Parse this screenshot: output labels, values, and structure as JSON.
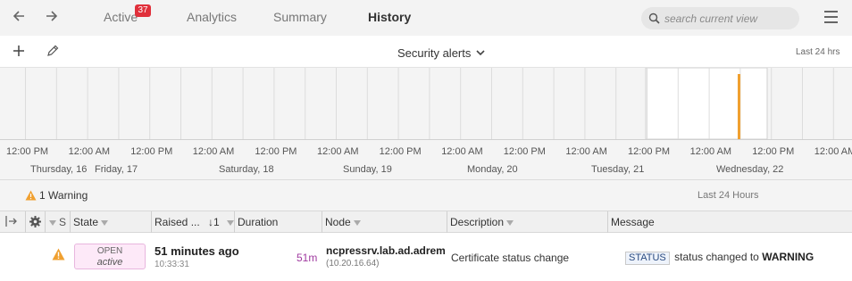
{
  "nav": {
    "tabs": [
      {
        "label": "Active",
        "badge": "37"
      },
      {
        "label": "Analytics"
      },
      {
        "label": "Summary"
      },
      {
        "label": "History"
      }
    ],
    "search_placeholder": "search current view"
  },
  "toolbar": {
    "view_name": "Security alerts",
    "time_range": "Last 24 hrs"
  },
  "timeline": {
    "tick_labels": [
      "12:00 PM",
      "12:00 AM",
      "12:00 PM",
      "12:00 AM",
      "12:00 PM",
      "12:00 AM",
      "12:00 PM",
      "12:00 AM",
      "12:00 PM",
      "12:00 AM",
      "12:00 PM",
      "12:00 AM",
      "12:00 PM",
      "12:00 AM"
    ],
    "day_labels": [
      "Thursday, 16",
      "Friday, 17",
      "Saturday, 18",
      "Sunday, 19",
      "Monday, 20",
      "Tuesday, 21",
      "Wednesday, 22"
    ],
    "event_color": "#f0a030"
  },
  "summary": {
    "warning_count_text": "1 Warning",
    "period": "Last 24 Hours"
  },
  "table": {
    "headers": {
      "state": "State",
      "raised": "Raised ...",
      "sort": "↓1",
      "duration": "Duration",
      "node": "Node",
      "description": "Description",
      "message": "Message",
      "severity_short": "S"
    },
    "rows": [
      {
        "severity": "warning",
        "state": "OPEN",
        "state_sub": "active",
        "raised": "51 minutes ago",
        "raised_time": "10:33:31",
        "duration": "51m",
        "node": "ncpressrv.lab.ad.adrem",
        "node_ip": "(10.20.16.64)",
        "description": "Certificate status change",
        "message_tag": "STATUS",
        "message_text": "status changed to",
        "message_value": "WARNING"
      }
    ]
  },
  "colors": {
    "warning": "#f0a030",
    "badge": "#e0303b",
    "duration": "#a03aa0"
  }
}
